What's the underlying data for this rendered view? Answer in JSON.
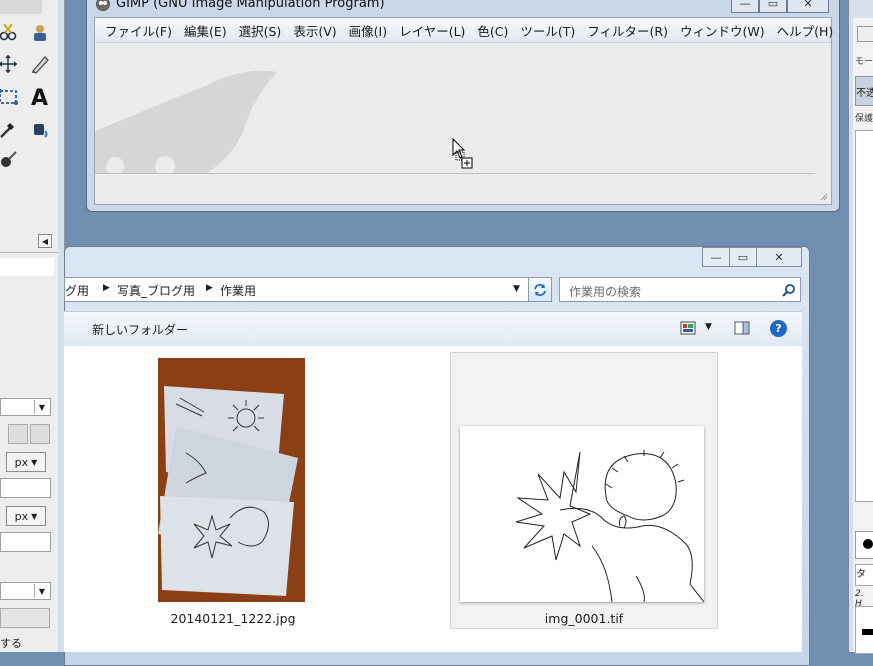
{
  "gimp": {
    "title": "GIMP (GNU Image Manipulation Program)",
    "menu": [
      "ファイル(F)",
      "編集(E)",
      "選択(S)",
      "表示(V)",
      "画像(I)",
      "レイヤー(L)",
      "色(C)",
      "ツール(T)",
      "フィルター(R)",
      "ウィンドウ(W)",
      "ヘルプ(H)"
    ]
  },
  "toolbox": {
    "unit1": "px",
    "unit2": "px",
    "bottom_text": "する"
  },
  "right_dock": {
    "mode_label": "モー",
    "mode_value": "不透",
    "protect_label": "保護",
    "brush_tag": "タ",
    "brush_name": "2. H"
  },
  "explorer": {
    "breadcrumb": [
      "グ用",
      "写真_ブログ用",
      "作業用"
    ],
    "search_placeholder": "作業用の検索",
    "new_folder_label": "新しいフォルダー",
    "files": [
      {
        "name": "20140121_1222.jpg"
      },
      {
        "name": "img_0001.tif"
      }
    ]
  },
  "colors": {
    "accent": "#1f6fc9",
    "window_frame": "#c9d7e8",
    "photo_bg": "#8b3f14"
  }
}
